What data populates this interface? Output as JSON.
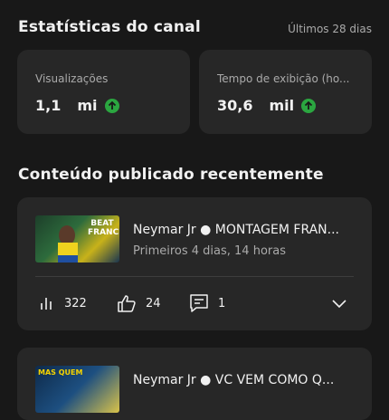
{
  "channel_stats": {
    "title": "Estatísticas do canal",
    "period": "Últimos 28 dias",
    "cards": [
      {
        "label": "Visualizações",
        "value": "1,1",
        "unit": "mi",
        "trend": "up-arrow-icon"
      },
      {
        "label": "Tempo de exibição (ho...",
        "value": "30,6",
        "unit": "mil",
        "trend": "up-arrow-icon"
      }
    ]
  },
  "recent": {
    "title": "Conteúdo publicado recentemente",
    "videos": [
      {
        "title": "Neymar Jr ● MONTAGEM FRAN...",
        "subtitle": "Primeiros 4 dias, 14 horas",
        "thumb_text": "BEAT FRANCE",
        "views": "322",
        "likes": "24",
        "comments": "1"
      },
      {
        "title": "Neymar Jr ● VC VEM COMO Q...",
        "thumb_text": "MAS QUEM"
      }
    ]
  },
  "colors": {
    "background": "#181818",
    "card": "#272727",
    "accent_green": "#2ba640",
    "muted": "#aaaaaa"
  }
}
